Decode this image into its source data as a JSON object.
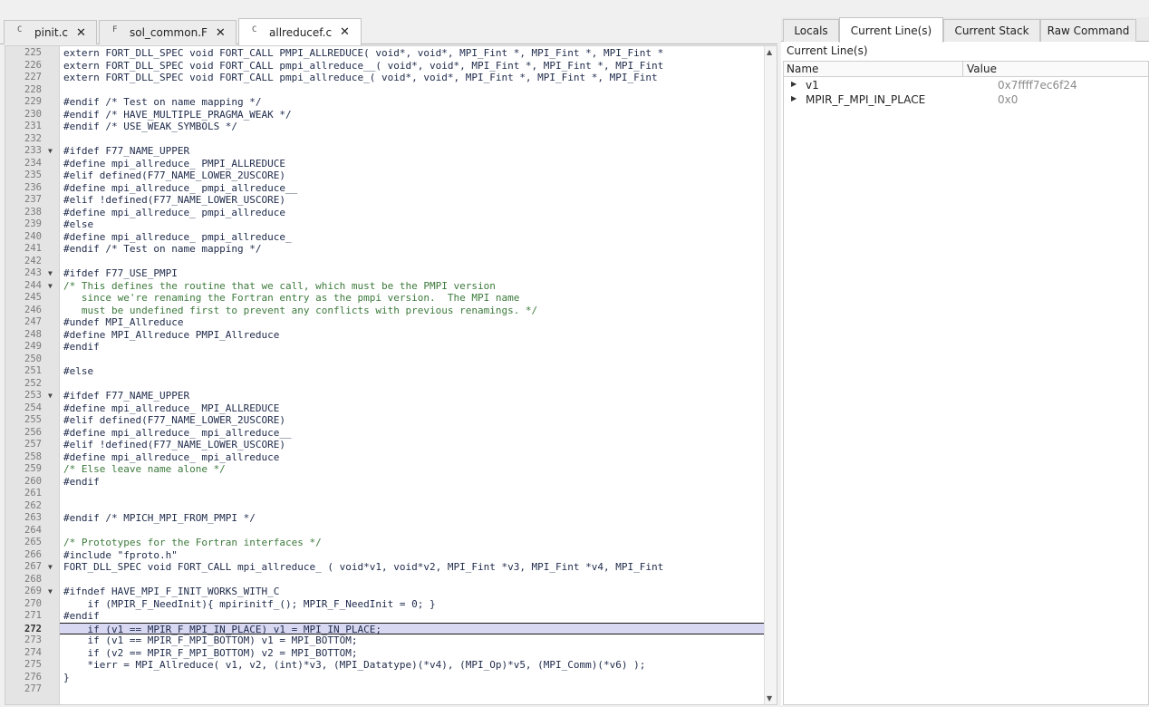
{
  "file_tabs": [
    {
      "label": "pinit.c",
      "icon": "c-file-icon",
      "glyph": "C"
    },
    {
      "label": "sol_common.F",
      "icon": "f-file-icon",
      "glyph": "F"
    },
    {
      "label": "allreducef.c",
      "icon": "c-file-icon",
      "glyph": "C",
      "active": true
    }
  ],
  "editor": {
    "lines": [
      {
        "n": "225",
        "t": "extern FORT_DLL_SPEC void FORT_CALL PMPI_ALLREDUCE( void*, void*, MPI_Fint *, MPI_Fint *, MPI_Fint *"
      },
      {
        "n": "226",
        "t": "extern FORT_DLL_SPEC void FORT_CALL pmpi_allreduce__( void*, void*, MPI_Fint *, MPI_Fint *, MPI_Fint"
      },
      {
        "n": "227",
        "t": "extern FORT_DLL_SPEC void FORT_CALL pmpi_allreduce_( void*, void*, MPI_Fint *, MPI_Fint *, MPI_Fint"
      },
      {
        "n": "228",
        "t": ""
      },
      {
        "n": "229",
        "t": "#endif /* Test on name mapping */"
      },
      {
        "n": "230",
        "t": "#endif /* HAVE_MULTIPLE_PRAGMA_WEAK */"
      },
      {
        "n": "231",
        "t": "#endif /* USE_WEAK_SYMBOLS */"
      },
      {
        "n": "232",
        "t": ""
      },
      {
        "n": "233",
        "t": "#ifdef F77_NAME_UPPER",
        "fold": true
      },
      {
        "n": "234",
        "t": "#define mpi_allreduce_ PMPI_ALLREDUCE"
      },
      {
        "n": "235",
        "t": "#elif defined(F77_NAME_LOWER_2USCORE)"
      },
      {
        "n": "236",
        "t": "#define mpi_allreduce_ pmpi_allreduce__"
      },
      {
        "n": "237",
        "t": "#elif !defined(F77_NAME_LOWER_USCORE)"
      },
      {
        "n": "238",
        "t": "#define mpi_allreduce_ pmpi_allreduce"
      },
      {
        "n": "239",
        "t": "#else"
      },
      {
        "n": "240",
        "t": "#define mpi_allreduce_ pmpi_allreduce_"
      },
      {
        "n": "241",
        "t": "#endif /* Test on name mapping */"
      },
      {
        "n": "242",
        "t": ""
      },
      {
        "n": "243",
        "t": "#ifdef F77_USE_PMPI",
        "fold": true
      },
      {
        "n": "244",
        "t": "/* This defines the routine that we call, which must be the PMPI version",
        "fold": true,
        "comment": true
      },
      {
        "n": "245",
        "t": "   since we're renaming the Fortran entry as the pmpi version.  The MPI name",
        "comment": true
      },
      {
        "n": "246",
        "t": "   must be undefined first to prevent any conflicts with previous renamings. */",
        "comment": true
      },
      {
        "n": "247",
        "t": "#undef MPI_Allreduce"
      },
      {
        "n": "248",
        "t": "#define MPI_Allreduce PMPI_Allreduce"
      },
      {
        "n": "249",
        "t": "#endif"
      },
      {
        "n": "250",
        "t": ""
      },
      {
        "n": "251",
        "t": "#else"
      },
      {
        "n": "252",
        "t": ""
      },
      {
        "n": "253",
        "t": "#ifdef F77_NAME_UPPER",
        "fold": true
      },
      {
        "n": "254",
        "t": "#define mpi_allreduce_ MPI_ALLREDUCE"
      },
      {
        "n": "255",
        "t": "#elif defined(F77_NAME_LOWER_2USCORE)"
      },
      {
        "n": "256",
        "t": "#define mpi_allreduce_ mpi_allreduce__"
      },
      {
        "n": "257",
        "t": "#elif !defined(F77_NAME_LOWER_USCORE)"
      },
      {
        "n": "258",
        "t": "#define mpi_allreduce_ mpi_allreduce"
      },
      {
        "n": "259",
        "t": "/* Else leave name alone */",
        "comment": true
      },
      {
        "n": "260",
        "t": "#endif"
      },
      {
        "n": "261",
        "t": ""
      },
      {
        "n": "262",
        "t": ""
      },
      {
        "n": "263",
        "t": "#endif /* MPICH_MPI_FROM_PMPI */"
      },
      {
        "n": "264",
        "t": ""
      },
      {
        "n": "265",
        "t": "/* Prototypes for the Fortran interfaces */",
        "comment": true
      },
      {
        "n": "266",
        "t": "#include \"fproto.h\""
      },
      {
        "n": "267",
        "t": "FORT_DLL_SPEC void FORT_CALL mpi_allreduce_ ( void*v1, void*v2, MPI_Fint *v3, MPI_Fint *v4, MPI_Fint",
        "fold": true
      },
      {
        "n": "268",
        "t": ""
      },
      {
        "n": "269",
        "t": "#ifndef HAVE_MPI_F_INIT_WORKS_WITH_C",
        "fold": true
      },
      {
        "n": "270",
        "t": "    if (MPIR_F_NeedInit){ mpirinitf_(); MPIR_F_NeedInit = 0; }"
      },
      {
        "n": "271",
        "t": "#endif"
      },
      {
        "n": "272",
        "t": "    if (v1 == MPIR_F_MPI_IN_PLACE) v1 = MPI_IN_PLACE;",
        "current": true
      },
      {
        "n": "273",
        "t": "    if (v1 == MPIR_F_MPI_BOTTOM) v1 = MPI_BOTTOM;"
      },
      {
        "n": "274",
        "t": "    if (v2 == MPIR_F_MPI_BOTTOM) v2 = MPI_BOTTOM;"
      },
      {
        "n": "275",
        "t": "    *ierr = MPI_Allreduce( v1, v2, (int)*v3, (MPI_Datatype)(*v4), (MPI_Op)*v5, (MPI_Comm)(*v6) );"
      },
      {
        "n": "276",
        "t": "}"
      },
      {
        "n": "277",
        "t": ""
      }
    ]
  },
  "right_panel": {
    "tabs": [
      "Locals",
      "Current Line(s)",
      "Current Stack",
      "Raw Command"
    ],
    "active_tab": "Current Line(s)",
    "title": "Current Line(s)",
    "columns": {
      "name": "Name",
      "value": "Value"
    },
    "rows": [
      {
        "name": "v1",
        "value": "0x7ffff7ec6f24"
      },
      {
        "name": "MPIR_F_MPI_IN_PLACE",
        "value": "0x0"
      }
    ]
  }
}
